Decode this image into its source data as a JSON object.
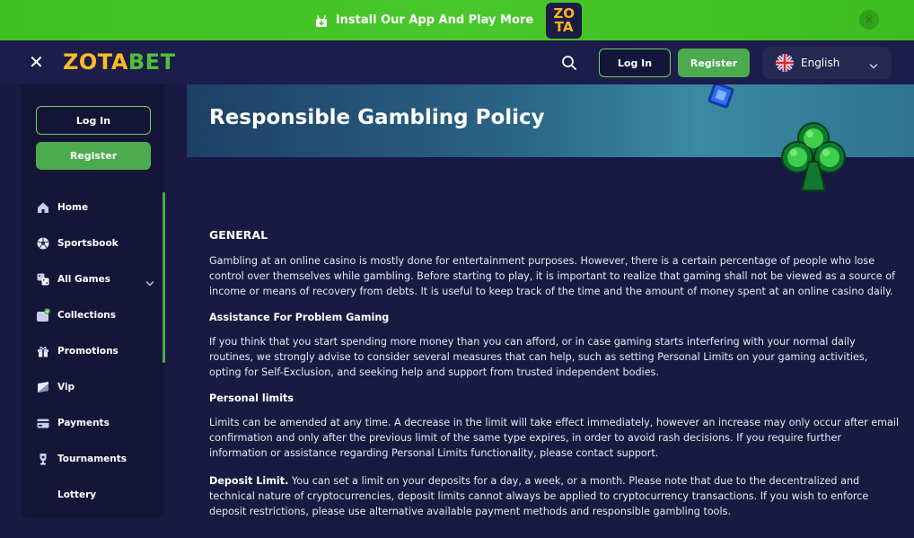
{
  "promo": {
    "text": "Install Our App And Play More",
    "logo_top": "ZO",
    "logo_bottom": "TA",
    "close": "×"
  },
  "header": {
    "close": "✕",
    "brand_zota": "ZOTA",
    "brand_bet": "BET",
    "login": "Log In",
    "register": "Register",
    "language": "English"
  },
  "sidebar": {
    "login": "Log In",
    "register": "Register",
    "items": [
      {
        "label": "Home",
        "icon": "home-icon"
      },
      {
        "label": "Sportsbook",
        "icon": "soccer-ball-icon"
      },
      {
        "label": "All Games",
        "icon": "dice-icon"
      },
      {
        "label": "Collections",
        "icon": "collection-icon"
      },
      {
        "label": "Promotions",
        "icon": "gift-icon"
      },
      {
        "label": "Vip",
        "icon": "vip-flag-icon"
      },
      {
        "label": "Payments",
        "icon": "wallet-icon"
      },
      {
        "label": "Tournaments",
        "icon": "trophy-icon"
      },
      {
        "label": "Lottery",
        "icon": ""
      }
    ]
  },
  "hero": {
    "title": "Responsible Gambling Policy"
  },
  "content": {
    "general_heading": "GENERAL",
    "general_text": "Gambling at an online casino is mostly done for entertainment purposes. However, there is a certain percentage of people who lose control over themselves while gambling. Before starting to play, it is important to realize that gaming shall not be viewed as a source of income or means of recovery from debts. It is useful to keep track of the time and the amount of money spent at an online casino daily.",
    "assistance_heading": "Assistance For Problem Gaming",
    "assistance_text": "If you think that you start spending more money than you can afford, or in case gaming starts interfering with your normal daily routines, we strongly advise to consider several measures that can help, such as setting Personal Limits on your gaming activities, opting for Self-Exclusion, and seeking help and support from trusted independent bodies.",
    "limits_heading": "Personal limits",
    "limits_text": "Limits can be amended at any time. A decrease in the limit will take effect immediately, however an increase may only occur after email confirmation and only after the previous limit of the same type expires, in order to avoid rash decisions. If you require further information or assistance regarding Personal Limits functionality, please contact support.",
    "deposit_label": "Deposit Limit.",
    "deposit_text": " You can set a limit on your deposits for a day, a week, or a month. Please note that due to the decentralized and technical nature of cryptocurrencies, deposit limits cannot always be applied to cryptocurrency transactions. If you wish to enforce deposit restrictions, please use alternative available payment methods and responsible gambling tools."
  }
}
